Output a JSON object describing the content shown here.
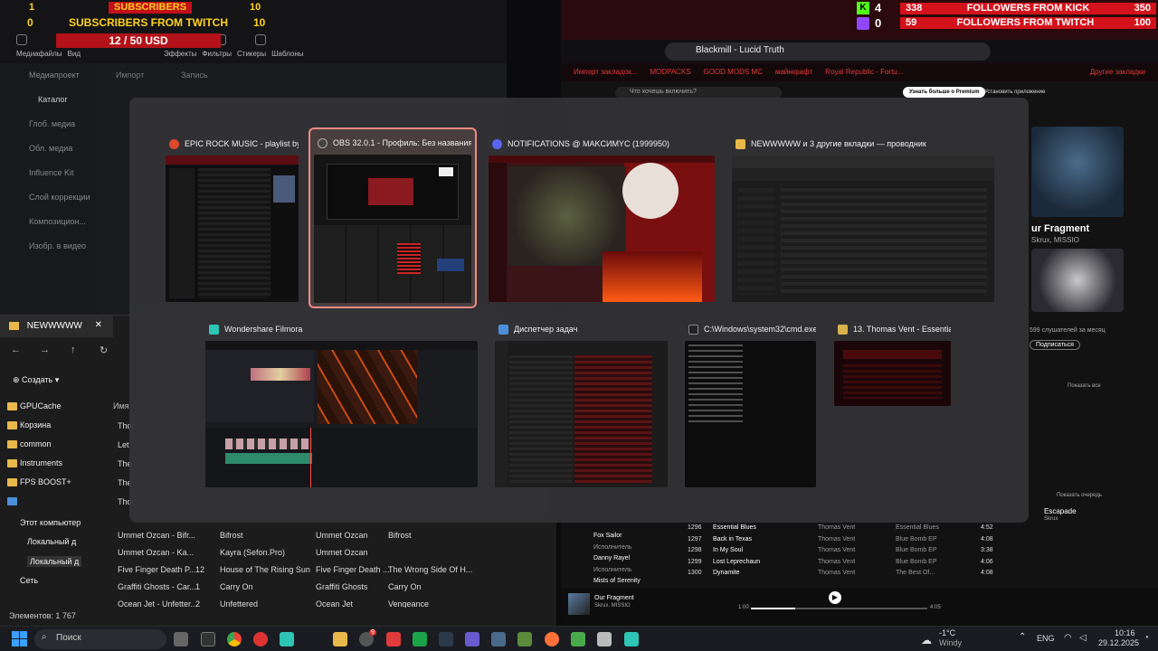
{
  "overlay": {
    "subs_label": "SUBSCRIBERS",
    "subs_left": "1",
    "subs_right": "10",
    "twitch_left": "0",
    "twitch_label": "SUBSCRIBERS FROM TWITCH",
    "twitch_right": "10",
    "goal": "12 / 50 USD",
    "kick_icon_count": "4",
    "kick_count": "338",
    "kick_label": "FOLLOWERS FROM KICK",
    "kick_goal": "350",
    "twitch_icon_count": "0",
    "twitch_f_count": "59",
    "twitch_f_label": "FOLLOWERS FROM TWITCH",
    "twitch_f_goal": "100"
  },
  "filmora_bg": {
    "tabs": [
      "Медиафайлы",
      "Вид",
      "",
      "Эффекты",
      "Фильтры",
      "Стикеры",
      "Шаблоны"
    ],
    "import": "Импорт",
    "record": "Запись",
    "project_media": "Медиапроект",
    "catalog": "Каталог",
    "sidebar": [
      "Глоб. медиа",
      "Обл. медиа",
      "Influence Kit",
      "Слой коррекции",
      "Композицион...",
      "Изобр. в видео"
    ]
  },
  "explorer_bg": {
    "tab_title": "NEWWWWW",
    "create": "Создать",
    "name_col": "Имя",
    "sidebar": [
      "GPUCache",
      "Корзина",
      "common",
      "Instruments",
      "FPS BOOST+"
    ],
    "this_pc": "Этот компьютер",
    "local1": "Локальный д",
    "local2": "Локальный д",
    "network": "Сеть",
    "rows": [
      {
        "name": "Ummet Ozcan - Bifr...",
        "num": "",
        "title": "Bifrost",
        "artist": "Ummet Ozcan",
        "album": "Bifrost"
      },
      {
        "name": "Ummet Ozcan - Ka...",
        "num": "",
        "title": "Kayra (Sefon.Pro)",
        "artist": "Ummet Ozcan",
        "album": ""
      },
      {
        "name": "Five Finger Death P...",
        "num": "12",
        "title": "House of The Rising Sun",
        "artist": "Five Finger Death ...",
        "album": "The Wrong Side Of H..."
      },
      {
        "name": "Graffiti Ghosts - Car...",
        "num": "1",
        "title": "Carry On",
        "artist": "Graffiti Ghosts",
        "album": "Carry On"
      },
      {
        "name": "Ocean Jet - Unfetter...",
        "num": "2",
        "title": "Unfettered",
        "artist": "Ocean Jet",
        "album": "Vengeance"
      }
    ],
    "partial_rows": [
      "Thor",
      "Let",
      "The",
      "The",
      "Thor"
    ],
    "status": "Элементов: 1 767"
  },
  "browser_bg": {
    "tab_title": "Blackmill - Lucid Truth",
    "search_placeholder": "Что хочешь включить?",
    "premium": "Узнать больше о Premium",
    "install": "Установить приложение",
    "bookmarks": [
      "Импорт закладок...",
      "MODPACKS",
      "GOOD MODS MC",
      "майнкрафт",
      "Royal Republic - Fortu...",
      "Другие закладки"
    ],
    "now_title": "Our Fragment",
    "now_artist": "Skrux, MISSIO",
    "np_header": "ur Fragment",
    "np_sub": "Skrux, MISSIO",
    "listeners": "599 слушателей за месяц",
    "subscribe": "Подписаться",
    "show_all": "Показать все",
    "queue": "Показать очередь",
    "next_title": "Escapade",
    "next_artist": "Skrux",
    "side_artists": [
      "Fox Sailor",
      "Danny Rayel",
      "Mists of Serenity"
    ],
    "side_role": "Исполнитель",
    "tracks": [
      {
        "n": "1296",
        "title": "Essential Blues",
        "artist": "Thomas Vent",
        "album": "Essential Blues",
        "dur": "4:52"
      },
      {
        "n": "1297",
        "title": "Back in Texas",
        "artist": "Thomas Vent",
        "album": "Blue Bomb EP",
        "dur": "4:08"
      },
      {
        "n": "1298",
        "title": "In My Soul",
        "artist": "Thomas Vent",
        "album": "Blue Bomb EP",
        "dur": "3:38"
      },
      {
        "n": "1299",
        "title": "Lost Leprechaun",
        "artist": "Thomas Vent",
        "album": "Blue Bomb EP",
        "dur": "4:06"
      },
      {
        "n": "1300",
        "title": "Dynamite",
        "artist": "Thomas Vent",
        "album": "The Best Of...",
        "dur": "4:08"
      }
    ],
    "time_cur": "1:00",
    "time_total": "4:05"
  },
  "switcher": {
    "windows": [
      {
        "title": "EPIC ROCK MUSIC - playlist by...",
        "icon_color": "#e0482c"
      },
      {
        "title": "OBS 32.0.1 - Профиль: Без названия - ...",
        "icon_color": "#3a3a3a"
      },
      {
        "title": "NOTIFICATIONS @ MAKCИMYC (1999950)",
        "icon_color": "#5865f2"
      },
      {
        "title": "NEWWWWW и 3 другие вкладки — проводник",
        "icon_color": "#e8b84a"
      },
      {
        "title": "Wondershare Filmora",
        "icon_color": "#2ec4b6"
      },
      {
        "title": "Диспетчер задач",
        "icon_color": "#4a90d9"
      },
      {
        "title": "C:\\Windows\\system32\\cmd.exe",
        "icon_color": "#222"
      },
      {
        "title": "13. Thomas Vent - Essentia...",
        "icon_color": "#d8b24a"
      }
    ],
    "selected_index": 1
  },
  "taskbar": {
    "search": "Поиск",
    "temp": "-1°C",
    "weather": "Windy",
    "lang": "ENG",
    "time": "10:16",
    "date": "29.12.2025",
    "badge": "9"
  }
}
